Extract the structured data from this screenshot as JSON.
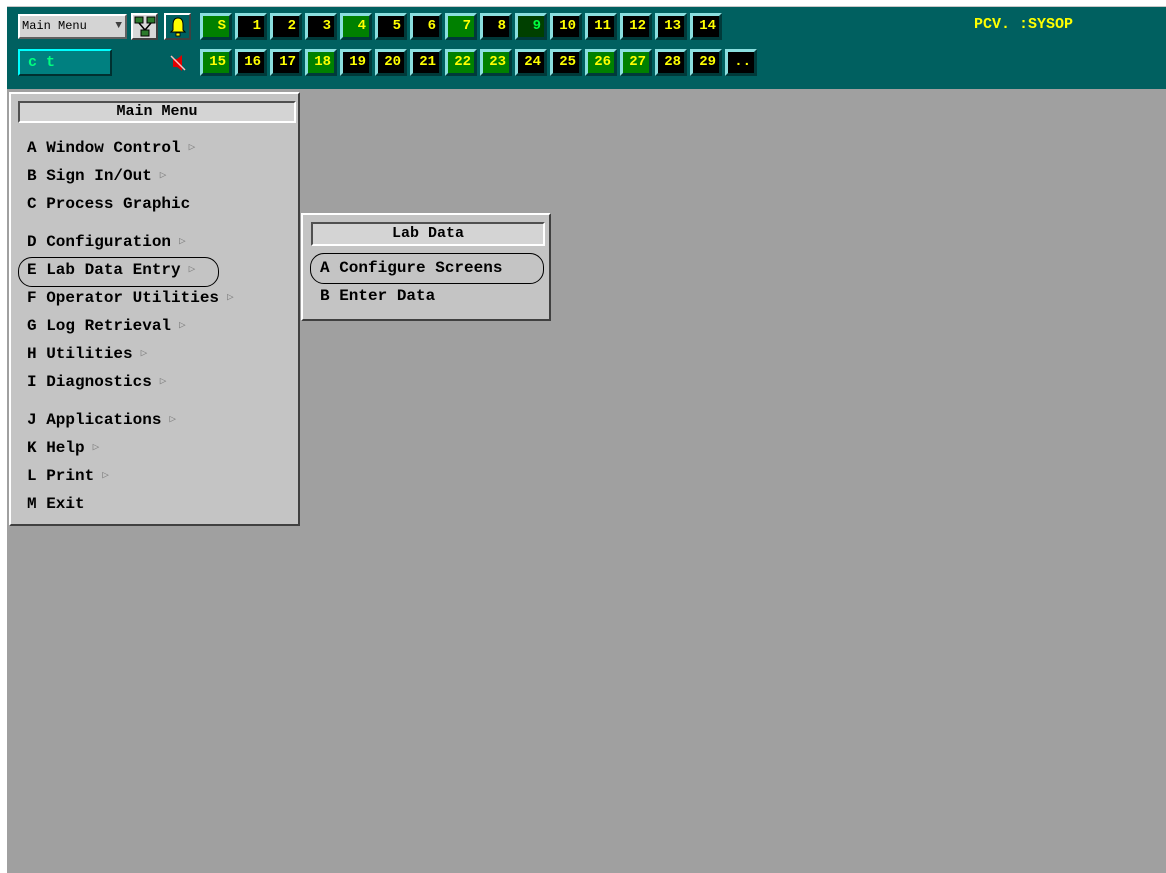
{
  "toolbar": {
    "menu_dropdown_label": "Main Menu",
    "command_field": "c t",
    "user_label": "PCV. :SYSOP",
    "row1_buttons": [
      {
        "label": "S",
        "style": "green"
      },
      {
        "label": "1",
        "style": "black"
      },
      {
        "label": "2",
        "style": "black"
      },
      {
        "label": "3",
        "style": "black"
      },
      {
        "label": "4",
        "style": "green"
      },
      {
        "label": "5",
        "style": "black"
      },
      {
        "label": "6",
        "style": "black"
      },
      {
        "label": "7",
        "style": "green"
      },
      {
        "label": "8",
        "style": "black"
      },
      {
        "label": "9",
        "style": "dark"
      },
      {
        "label": "10",
        "style": "black"
      },
      {
        "label": "11",
        "style": "black"
      },
      {
        "label": "12",
        "style": "black"
      },
      {
        "label": "13",
        "style": "black"
      },
      {
        "label": "14",
        "style": "black"
      }
    ],
    "row2_buttons": [
      {
        "label": "15",
        "style": "green"
      },
      {
        "label": "16",
        "style": "black"
      },
      {
        "label": "17",
        "style": "black"
      },
      {
        "label": "18",
        "style": "green"
      },
      {
        "label": "19",
        "style": "black"
      },
      {
        "label": "20",
        "style": "black"
      },
      {
        "label": "21",
        "style": "black"
      },
      {
        "label": "22",
        "style": "green"
      },
      {
        "label": "23",
        "style": "green"
      },
      {
        "label": "24",
        "style": "black"
      },
      {
        "label": "25",
        "style": "black"
      },
      {
        "label": "26",
        "style": "green"
      },
      {
        "label": "27",
        "style": "green"
      },
      {
        "label": "28",
        "style": "black"
      },
      {
        "label": "29",
        "style": "black"
      },
      {
        "label": "..",
        "style": "black"
      }
    ]
  },
  "main_menu": {
    "title": "Main Menu",
    "items": [
      {
        "label": "A Window Control",
        "submenu": true
      },
      {
        "label": "B Sign In/Out",
        "submenu": true
      },
      {
        "label": "C Process Graphic",
        "submenu": false
      },
      {
        "label": "D Configuration",
        "submenu": true
      },
      {
        "label": "E Lab Data Entry",
        "submenu": true
      },
      {
        "label": "F Operator Utilities",
        "submenu": true
      },
      {
        "label": "G Log Retrieval",
        "submenu": true
      },
      {
        "label": "H Utilities",
        "submenu": true
      },
      {
        "label": "I Diagnostics",
        "submenu": true
      },
      {
        "label": "J Applications",
        "submenu": true
      },
      {
        "label": "K Help",
        "submenu": true
      },
      {
        "label": "L Print",
        "submenu": true
      },
      {
        "label": "M Exit",
        "submenu": false
      }
    ]
  },
  "lab_menu": {
    "title": "Lab Data",
    "items": [
      {
        "label": "A Configure Screens"
      },
      {
        "label": "B Enter Data"
      }
    ]
  },
  "colors": {
    "toolbar_bg": "#006060",
    "workspace_bg": "#a0a0a0",
    "button_text": "#ffff00"
  },
  "icons": [
    "network-icon",
    "bell-icon",
    "speaker-icon",
    "submenu-arrow-icon",
    "dropdown-arrow-icon"
  ]
}
